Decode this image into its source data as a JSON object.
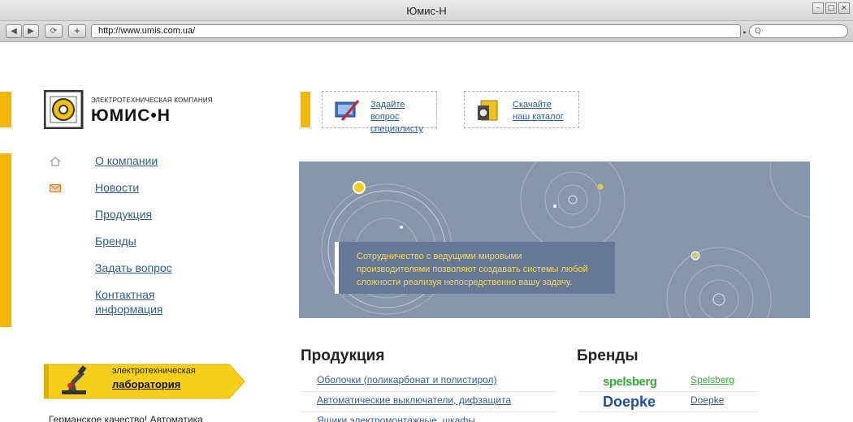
{
  "window": {
    "title": "Юмис-Н"
  },
  "toolbar": {
    "url": "http://www.umis.com.ua/",
    "search_placeholder": "Q·"
  },
  "logo": {
    "caption": "ЭЛЕКТРОТЕХНИЧЕСКАЯ КОМПАНИЯ",
    "name": "ЮМИС•Н"
  },
  "quick_links": [
    {
      "line1": "Задайте вопрос",
      "line2": "специалисту",
      "icon": "question-form-icon"
    },
    {
      "line1": "Скачайте",
      "line2": "наш каталог",
      "icon": "catalog-icon"
    }
  ],
  "nav": [
    {
      "label": "О компании",
      "icon": "home-icon"
    },
    {
      "label": "Новости",
      "icon": "mail-icon"
    },
    {
      "label": "Продукция"
    },
    {
      "label": "Бренды"
    },
    {
      "label": "Задать вопрос"
    },
    {
      "label": "Контактная",
      "label2": "информация"
    }
  ],
  "banner": {
    "line1": "Сотрудничество с ведущими мировыми",
    "line2": "производителями позволяют создавать системы любой",
    "line3": "сложности реализуя непосредственно вашу задачу."
  },
  "lab": {
    "line1": "электротехническая",
    "line2": "лаборатория"
  },
  "lab_text": "Германское качество! Автоматика",
  "products": {
    "title": "Продукция",
    "items": [
      "Оболочки (поликарбонат и полистирол)",
      "Автоматические выключатели, дифзащита",
      "Ящики электромонтажные, шкафы"
    ]
  },
  "brands": {
    "title": "Бренды",
    "items": [
      {
        "logo": "spelsberg",
        "name": "Spelsberg",
        "color": "#3aa83a"
      },
      {
        "logo": "Doepke",
        "name": "Doepke",
        "color": "#2f5e8c"
      }
    ]
  },
  "colors": {
    "accent_yellow": "#f2b705",
    "link_blue": "#2f5e8c",
    "banner_bg": "#8796ad"
  }
}
